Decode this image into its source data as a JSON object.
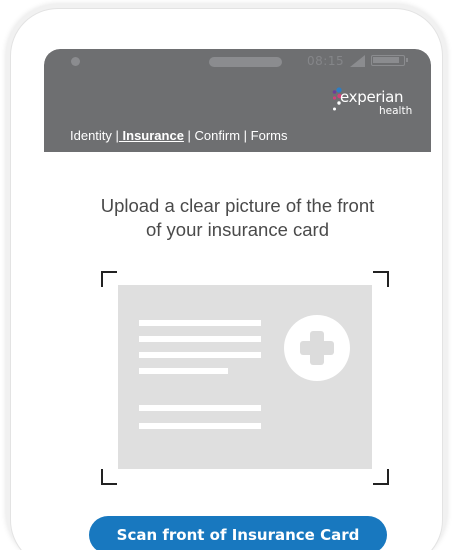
{
  "status_bar": {
    "time": "08:15"
  },
  "brand": {
    "name": "experian",
    "sub": "health"
  },
  "nav": {
    "identity": "Identity |",
    "insurance": " Insurance",
    "confirm": " | Confirm |",
    "forms": " Forms"
  },
  "instruction": {
    "line1": "Upload a clear picture of the front",
    "line2": "of your insurance card"
  },
  "scan_button": {
    "label": "Scan front of Insurance Card"
  },
  "icons": {
    "card": "insurance-card-icon",
    "plus": "plus-icon",
    "logo": "experian-logo-icon"
  },
  "colors": {
    "header": "#6e6f71",
    "button": "#1878bf",
    "card": "#dfdfdf",
    "logo_pink": "#d1417a",
    "logo_purple": "#6b3e99",
    "logo_blue": "#2d7dc3"
  }
}
